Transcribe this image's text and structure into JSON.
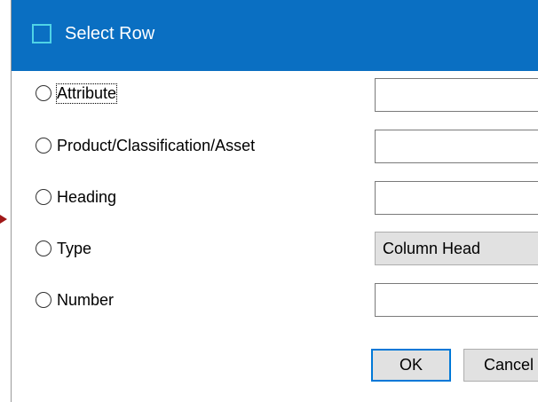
{
  "dialog": {
    "title": "Select Row"
  },
  "options": [
    {
      "label": "Attribute",
      "selected": false,
      "focused": true
    },
    {
      "label": "Product/Classification/Asset",
      "selected": false,
      "focused": false
    },
    {
      "label": "Heading",
      "selected": false,
      "focused": false
    },
    {
      "label": "Type",
      "selected": false,
      "focused": false
    },
    {
      "label": "Number",
      "selected": false,
      "focused": false
    }
  ],
  "fields": {
    "attribute_value": "",
    "product_value": "",
    "heading_value": "",
    "type_selected": "Column Head",
    "number_value": ""
  },
  "buttons": {
    "ok_label": "OK",
    "cancel_label": "Cancel"
  },
  "colors": {
    "titlebar": "#0a6fc2",
    "title_icon": "#4fd3e6",
    "default_button_border": "#0078d7",
    "arrow": "#a01818"
  }
}
